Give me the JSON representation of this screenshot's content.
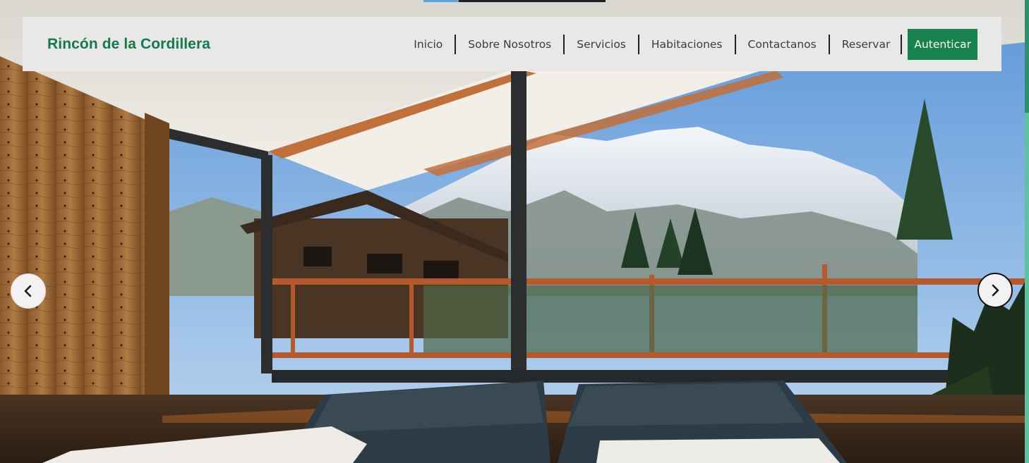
{
  "brand": {
    "name": "Rincón de la Cordillera",
    "color": "#157a4a"
  },
  "nav": {
    "links": [
      {
        "label": "Inicio"
      },
      {
        "label": "Sobre Nosotros"
      },
      {
        "label": "Servicios"
      },
      {
        "label": "Habitaciones"
      },
      {
        "label": "Contactanos"
      },
      {
        "label": "Reservar"
      }
    ],
    "auth_button": "Autenticar",
    "auth_button_color": "#18824e"
  },
  "carousel": {
    "prev_icon": "chevron-left-icon",
    "next_icon": "chevron-right-icon"
  }
}
